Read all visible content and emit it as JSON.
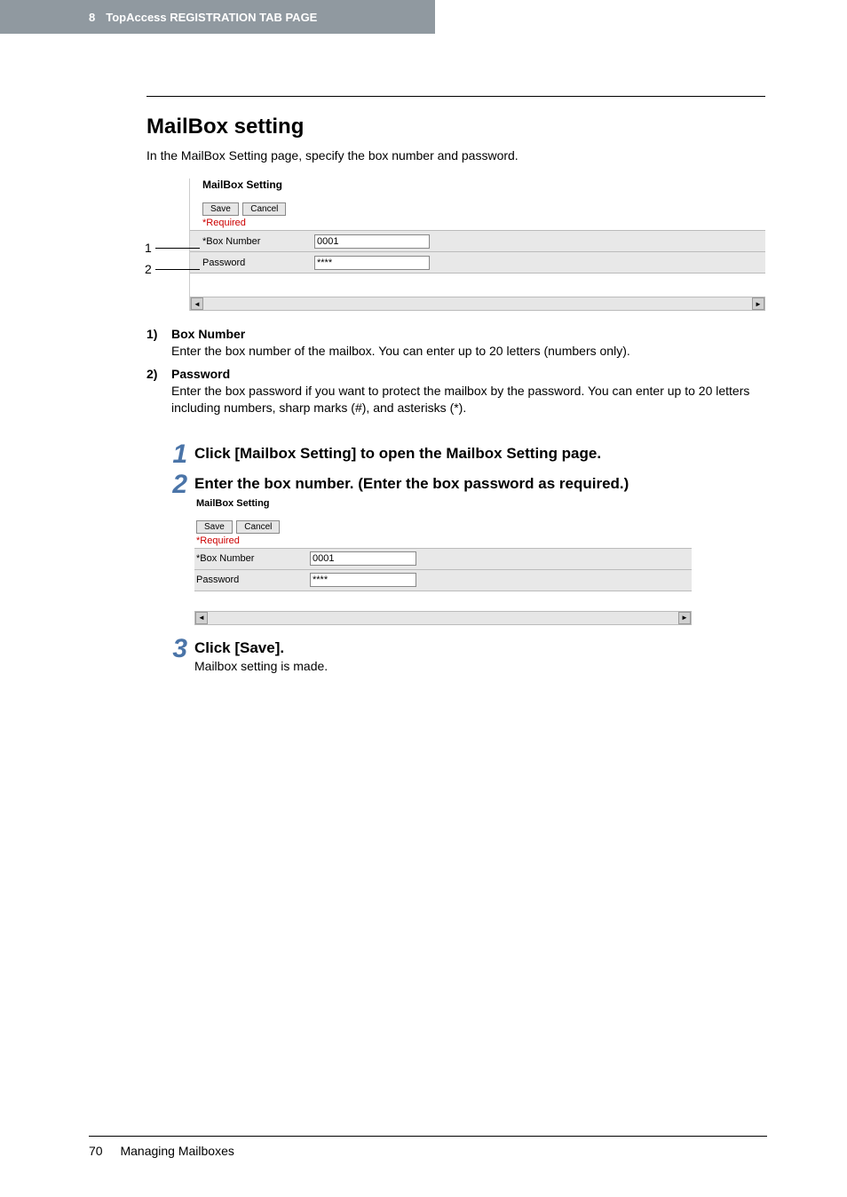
{
  "header": {
    "chapter_num": "8",
    "chapter_title": "TopAccess REGISTRATION TAB PAGE"
  },
  "section": {
    "title": "MailBox setting",
    "intro": "In the MailBox Setting page, specify the box number and password."
  },
  "shot1": {
    "title": "MailBox Setting",
    "save": "Save",
    "cancel": "Cancel",
    "required": "*Required",
    "row1_label": "*Box Number",
    "row1_value": "0001",
    "row2_label": "Password",
    "row2_value": "****",
    "callout1": "1",
    "callout2": "2"
  },
  "items": [
    {
      "num": "1)",
      "title": "Box Number",
      "text": "Enter the box number of the mailbox.  You can enter up to 20 letters (numbers only)."
    },
    {
      "num": "2)",
      "title": "Password",
      "text": "Enter the box password if you want to protect the mailbox by the password.  You can enter up to 20 letters including numbers, sharp marks (#), and asterisks (*)."
    }
  ],
  "steps": {
    "s1_num": "1",
    "s1_heading": "Click [Mailbox Setting] to open the Mailbox Setting page.",
    "s2_num": "2",
    "s2_heading": "Enter the box number. (Enter the box password as required.)",
    "s3_num": "3",
    "s3_heading": "Click [Save].",
    "s3_text": "Mailbox setting is made."
  },
  "shot2": {
    "title": "MailBox Setting",
    "save": "Save",
    "cancel": "Cancel",
    "required": "*Required",
    "row1_label": "*Box Number",
    "row1_value": "0001",
    "row2_label": "Password",
    "row2_value": "****"
  },
  "footer": {
    "page_num": "70",
    "section": "Managing Mailboxes"
  }
}
